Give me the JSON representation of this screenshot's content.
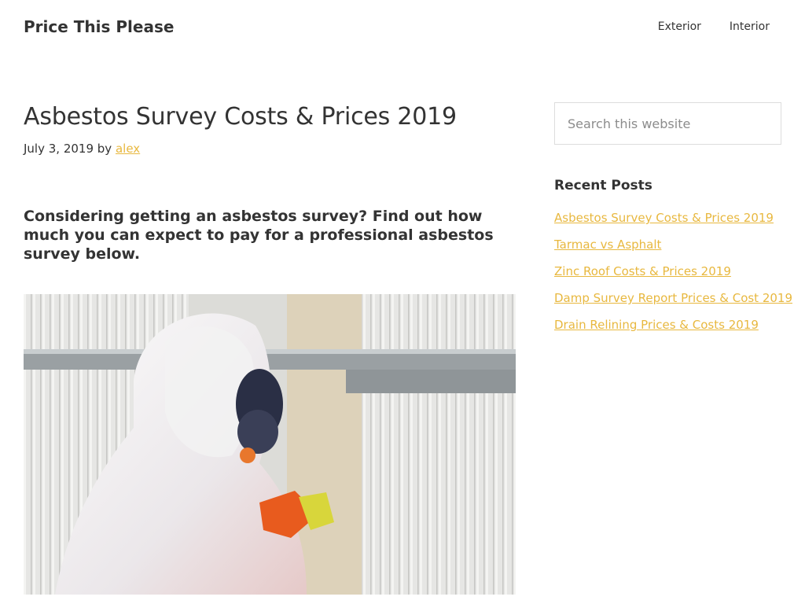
{
  "header": {
    "site_title": "Price This Please",
    "nav": [
      "Exterior",
      "Interior"
    ]
  },
  "post": {
    "title": "Asbestos Survey Costs & Prices 2019",
    "date": "July 3, 2019",
    "by": "by",
    "author": "alex",
    "lead": "Considering getting an asbestos survey? Find out how much you can expect to pay for a professional asbestos survey below."
  },
  "sidebar": {
    "search_placeholder": "Search this website",
    "recent_title": "Recent Posts",
    "recent_posts": [
      "Asbestos Survey Costs & Prices 2019",
      "Tarmac vs Asphalt",
      "Zinc Roof Costs & Prices 2019",
      "Damp Survey Report Prices & Cost 2019",
      "Drain Relining Prices & Costs 2019"
    ]
  },
  "colors": {
    "link_accent": "#e8b83f",
    "text": "#333333"
  }
}
